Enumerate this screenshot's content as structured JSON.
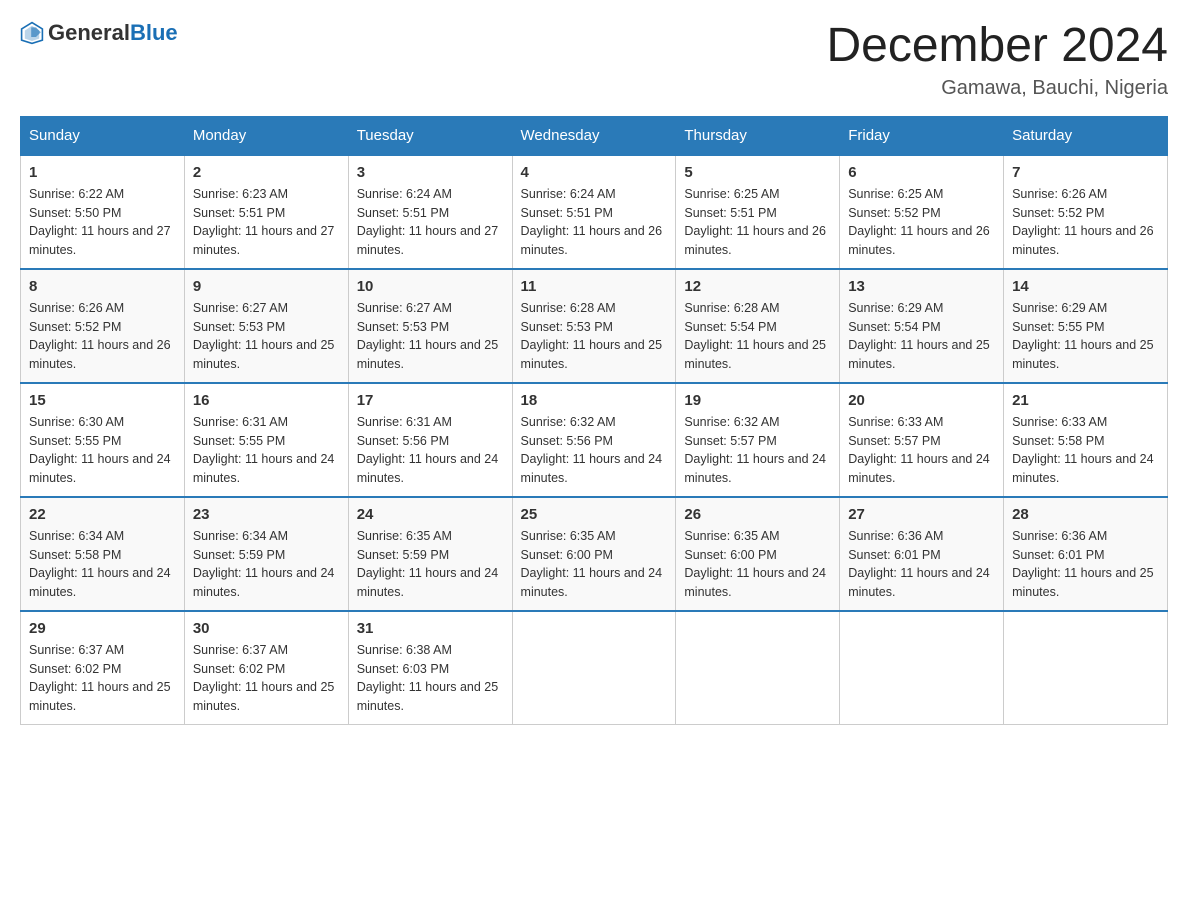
{
  "logo": {
    "general": "General",
    "blue": "Blue"
  },
  "title": "December 2024",
  "location": "Gamawa, Bauchi, Nigeria",
  "days_of_week": [
    "Sunday",
    "Monday",
    "Tuesday",
    "Wednesday",
    "Thursday",
    "Friday",
    "Saturday"
  ],
  "weeks": [
    [
      {
        "day": "1",
        "sunrise": "6:22 AM",
        "sunset": "5:50 PM",
        "daylight": "11 hours and 27 minutes."
      },
      {
        "day": "2",
        "sunrise": "6:23 AM",
        "sunset": "5:51 PM",
        "daylight": "11 hours and 27 minutes."
      },
      {
        "day": "3",
        "sunrise": "6:24 AM",
        "sunset": "5:51 PM",
        "daylight": "11 hours and 27 minutes."
      },
      {
        "day": "4",
        "sunrise": "6:24 AM",
        "sunset": "5:51 PM",
        "daylight": "11 hours and 26 minutes."
      },
      {
        "day": "5",
        "sunrise": "6:25 AM",
        "sunset": "5:51 PM",
        "daylight": "11 hours and 26 minutes."
      },
      {
        "day": "6",
        "sunrise": "6:25 AM",
        "sunset": "5:52 PM",
        "daylight": "11 hours and 26 minutes."
      },
      {
        "day": "7",
        "sunrise": "6:26 AM",
        "sunset": "5:52 PM",
        "daylight": "11 hours and 26 minutes."
      }
    ],
    [
      {
        "day": "8",
        "sunrise": "6:26 AM",
        "sunset": "5:52 PM",
        "daylight": "11 hours and 26 minutes."
      },
      {
        "day": "9",
        "sunrise": "6:27 AM",
        "sunset": "5:53 PM",
        "daylight": "11 hours and 25 minutes."
      },
      {
        "day": "10",
        "sunrise": "6:27 AM",
        "sunset": "5:53 PM",
        "daylight": "11 hours and 25 minutes."
      },
      {
        "day": "11",
        "sunrise": "6:28 AM",
        "sunset": "5:53 PM",
        "daylight": "11 hours and 25 minutes."
      },
      {
        "day": "12",
        "sunrise": "6:28 AM",
        "sunset": "5:54 PM",
        "daylight": "11 hours and 25 minutes."
      },
      {
        "day": "13",
        "sunrise": "6:29 AM",
        "sunset": "5:54 PM",
        "daylight": "11 hours and 25 minutes."
      },
      {
        "day": "14",
        "sunrise": "6:29 AM",
        "sunset": "5:55 PM",
        "daylight": "11 hours and 25 minutes."
      }
    ],
    [
      {
        "day": "15",
        "sunrise": "6:30 AM",
        "sunset": "5:55 PM",
        "daylight": "11 hours and 24 minutes."
      },
      {
        "day": "16",
        "sunrise": "6:31 AM",
        "sunset": "5:55 PM",
        "daylight": "11 hours and 24 minutes."
      },
      {
        "day": "17",
        "sunrise": "6:31 AM",
        "sunset": "5:56 PM",
        "daylight": "11 hours and 24 minutes."
      },
      {
        "day": "18",
        "sunrise": "6:32 AM",
        "sunset": "5:56 PM",
        "daylight": "11 hours and 24 minutes."
      },
      {
        "day": "19",
        "sunrise": "6:32 AM",
        "sunset": "5:57 PM",
        "daylight": "11 hours and 24 minutes."
      },
      {
        "day": "20",
        "sunrise": "6:33 AM",
        "sunset": "5:57 PM",
        "daylight": "11 hours and 24 minutes."
      },
      {
        "day": "21",
        "sunrise": "6:33 AM",
        "sunset": "5:58 PM",
        "daylight": "11 hours and 24 minutes."
      }
    ],
    [
      {
        "day": "22",
        "sunrise": "6:34 AM",
        "sunset": "5:58 PM",
        "daylight": "11 hours and 24 minutes."
      },
      {
        "day": "23",
        "sunrise": "6:34 AM",
        "sunset": "5:59 PM",
        "daylight": "11 hours and 24 minutes."
      },
      {
        "day": "24",
        "sunrise": "6:35 AM",
        "sunset": "5:59 PM",
        "daylight": "11 hours and 24 minutes."
      },
      {
        "day": "25",
        "sunrise": "6:35 AM",
        "sunset": "6:00 PM",
        "daylight": "11 hours and 24 minutes."
      },
      {
        "day": "26",
        "sunrise": "6:35 AM",
        "sunset": "6:00 PM",
        "daylight": "11 hours and 24 minutes."
      },
      {
        "day": "27",
        "sunrise": "6:36 AM",
        "sunset": "6:01 PM",
        "daylight": "11 hours and 24 minutes."
      },
      {
        "day": "28",
        "sunrise": "6:36 AM",
        "sunset": "6:01 PM",
        "daylight": "11 hours and 25 minutes."
      }
    ],
    [
      {
        "day": "29",
        "sunrise": "6:37 AM",
        "sunset": "6:02 PM",
        "daylight": "11 hours and 25 minutes."
      },
      {
        "day": "30",
        "sunrise": "6:37 AM",
        "sunset": "6:02 PM",
        "daylight": "11 hours and 25 minutes."
      },
      {
        "day": "31",
        "sunrise": "6:38 AM",
        "sunset": "6:03 PM",
        "daylight": "11 hours and 25 minutes."
      },
      null,
      null,
      null,
      null
    ]
  ],
  "labels": {
    "sunrise": "Sunrise:",
    "sunset": "Sunset:",
    "daylight": "Daylight:"
  }
}
